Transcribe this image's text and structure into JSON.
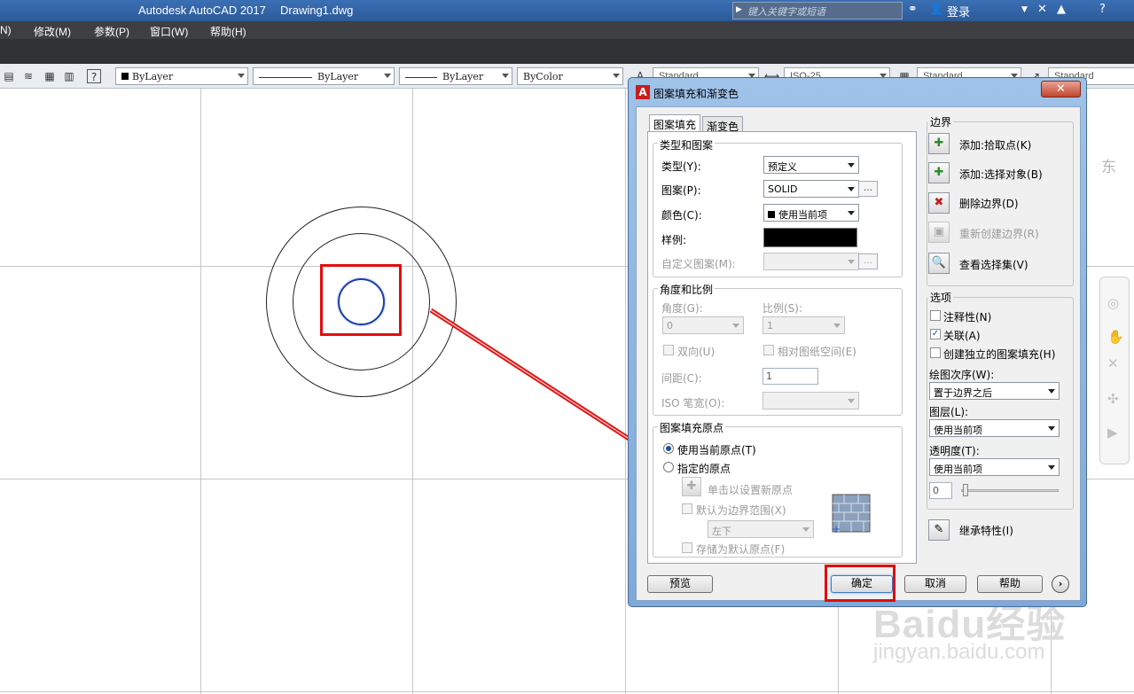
{
  "titlebar": {
    "app_title": "Autodesk AutoCAD 2017",
    "doc_title": "Drawing1.dwg",
    "search_placeholder": "键入关键字或短语",
    "login_label": "登录"
  },
  "menubar": {
    "items": [
      "N)",
      "修改(M)",
      "参数(P)",
      "窗口(W)",
      "帮助(H)"
    ]
  },
  "toolbar": {
    "color_combo": "ByLayer",
    "linetype_combo": "ByLayer",
    "lineweight_combo": "ByLayer",
    "plotstyle_combo": "ByColor",
    "text_style": "Standard",
    "dim_style": "ISO-25",
    "table_style": "Standard",
    "mleader_style": "Standard"
  },
  "viewcube": {
    "label": "东"
  },
  "dialog": {
    "title": "图案填充和渐变色",
    "close_label": "✕",
    "tabs": [
      "图案填充",
      "渐变色"
    ],
    "type_pattern": {
      "group": "类型和图案",
      "type_label": "类型(Y):",
      "type_value": "预定义",
      "pattern_label": "图案(P):",
      "pattern_value": "SOLID",
      "color_label": "颜色(C):",
      "color_value": "使用当前项",
      "sample_label": "样例:",
      "custom_label": "自定义图案(M):"
    },
    "angle_scale": {
      "group": "角度和比例",
      "angle_label": "角度(G):",
      "angle_value": "0",
      "scale_label": "比例(S):",
      "scale_value": "1",
      "double_label": "双向(U)",
      "relative_label": "相对图纸空间(E)",
      "spacing_label": "间距(C):",
      "spacing_value": "1",
      "iso_label": "ISO 笔宽(O):"
    },
    "origin": {
      "group": "图案填充原点",
      "current_label": "使用当前原点(T)",
      "specified_label": "指定的原点",
      "click_label": "单击以设置新原点",
      "default_extents_label": "默认为边界范围(X)",
      "position_value": "左下",
      "store_label": "存储为默认原点(F)"
    },
    "boundaries": {
      "group": "边界",
      "add_pick_label": "添加:拾取点(K)",
      "add_select_label": "添加:选择对象(B)",
      "remove_label": "删除边界(D)",
      "recreate_label": "重新创建边界(R)",
      "view_label": "查看选择集(V)"
    },
    "options": {
      "group": "选项",
      "annotative_label": "注释性(N)",
      "associative_label": "关联(A)",
      "separate_label": "创建独立的图案填充(H)",
      "draw_order_label": "绘图次序(W):",
      "draw_order_value": "置于边界之后",
      "layer_label": "图层(L):",
      "layer_value": "使用当前项",
      "transparency_label": "透明度(T):",
      "transparency_value": "使用当前项",
      "transparency_number": "0"
    },
    "inherit_label": "继承特性(I)",
    "buttons": {
      "preview": "预览",
      "ok": "确定",
      "cancel": "取消",
      "help": "帮助"
    }
  },
  "watermark": {
    "brand": "Baidu经验",
    "url": "jingyan.baidu.com"
  }
}
